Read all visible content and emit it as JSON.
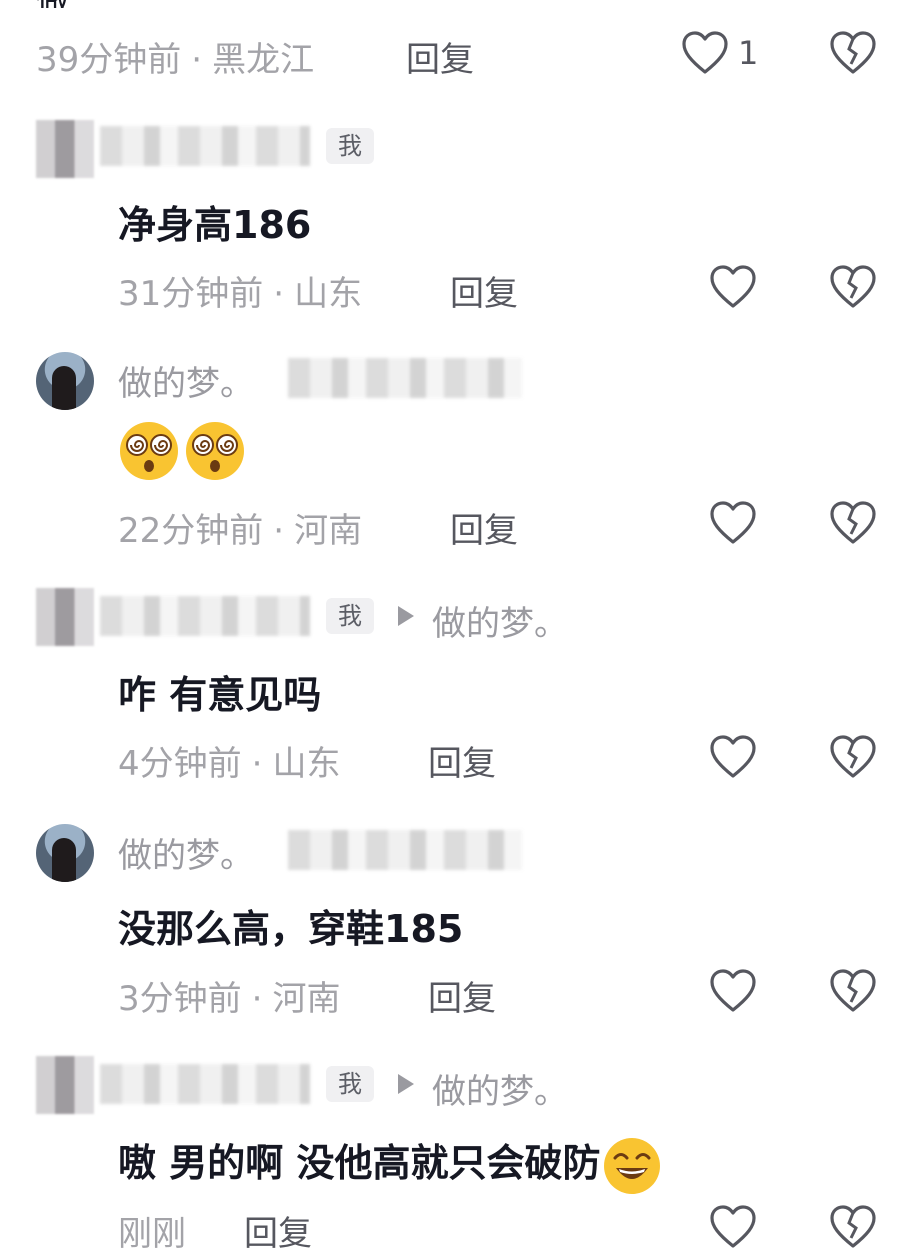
{
  "comments": [
    {
      "time": "39分钟前",
      "location": "黑龙江",
      "reply": "回复",
      "likes": "1"
    },
    {
      "username": "",
      "tag": "我",
      "content": "净身高186",
      "time": "31分钟前",
      "location": "山东",
      "reply": "回复"
    },
    {
      "username": "做的梦。",
      "content": "",
      "emoji": "dizzy-face-icon",
      "time": "22分钟前",
      "location": "河南",
      "reply": "回复"
    },
    {
      "tag": "我",
      "reply_target": "做的梦。",
      "content": "咋 有意见吗",
      "time": "4分钟前",
      "location": "山东",
      "reply": "回复"
    },
    {
      "username": "做的梦。",
      "content": "没那么高，穿鞋185",
      "time": "3分钟前",
      "location": "河南",
      "reply": "回复"
    },
    {
      "tag": "我",
      "reply_target": "做的梦。",
      "content": "嗷 男的啊 没他高就只会破防",
      "emoji": "grin-squint-icon",
      "time": "刚刚",
      "reply": "回复"
    }
  ],
  "meta_separator": "·",
  "colors": {
    "text": "#161823",
    "muted": "#a3a3a8",
    "reply": "#56575f",
    "tag_bg": "#f0f0f2"
  }
}
